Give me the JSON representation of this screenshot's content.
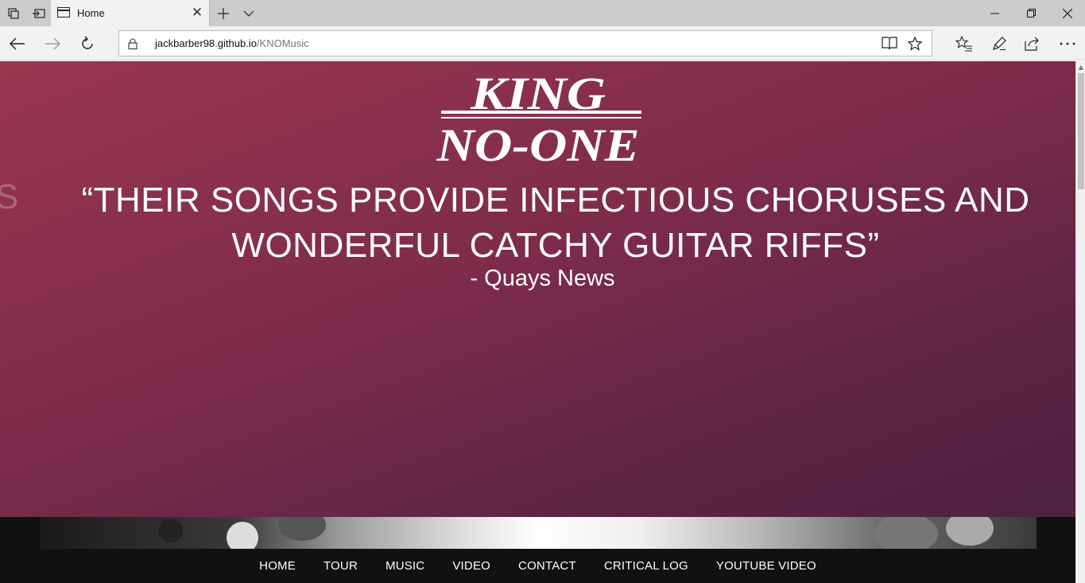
{
  "browser": {
    "tab": {
      "title": "Home"
    },
    "url": {
      "domain": "jackbarber98.github.io",
      "path": "/KNOMusic"
    }
  },
  "page": {
    "logo": {
      "line1": "KING",
      "line2": "NO-ONE"
    },
    "ghost_letter": "S",
    "quote": "“THEIR SONGS PROVIDE INFECTIOUS CHORUSES AND WONDERFUL CATCHY GUITAR RIFFS”",
    "quote_source": "- Quays News",
    "nav": [
      "HOME",
      "TOUR",
      "MUSIC",
      "VIDEO",
      "CONTACT",
      "CRITICAL LOG",
      "YOUTUBE VIDEO"
    ]
  }
}
